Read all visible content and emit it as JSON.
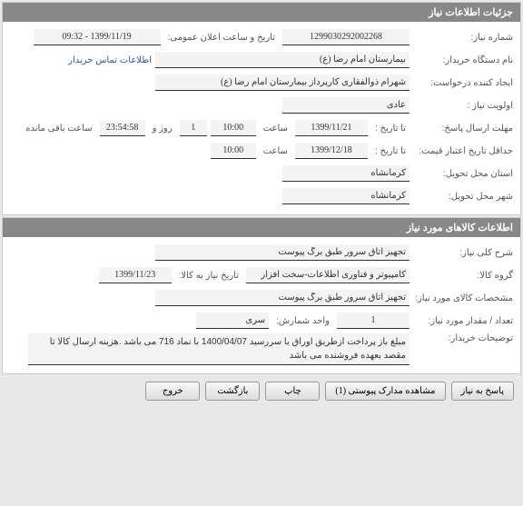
{
  "sections": {
    "info": {
      "title": "جزئیات اطلاعات نیاز"
    },
    "goods": {
      "title": "اطلاعات کالاهای مورد نیاز"
    }
  },
  "labels": {
    "request_no": "شماره نیاز:",
    "announce_datetime": "تاریخ و ساعت اعلان عمومی:",
    "buyer_name": "نام دستگاه خریدار:",
    "contact_link": "اطلاعات تماس خریدار",
    "requester": "ایجاد کننده درخواست:",
    "priority": "اولویت نیاز :",
    "deadline": "مهلت ارسال پاسخ:",
    "to_date": "تا تاریخ :",
    "time": "ساعت",
    "day_and": "روز و",
    "remaining": "ساعت باقی مانده",
    "min_validity": "حداقل تاریخ اعتبار قیمت:",
    "delivery_province": "استان محل تحویل:",
    "delivery_city": "شهر محل تحویل:",
    "general_desc": "شرح کلی نیاز:",
    "goods_group": "گروه کالا:",
    "goods_date": "تاریخ نیاز به کالا:",
    "goods_spec": "مشخصات کالای مورد نیاز:",
    "qty": "تعداد / مقدار مورد نیاز:",
    "unit": "واحد شمارش:",
    "buyer_notes": "توضیحات خریدار:"
  },
  "values": {
    "request_no": "1299030292002268",
    "announce_datetime": "1399/11/19 - 09:32",
    "buyer_name": "بیمارستان امام رضا (ع)",
    "requester": "شهرام ذوالفقاری کارپرداز بیمارستان امام رضا (ع)",
    "priority": "عادی",
    "deadline_date": "1399/11/21",
    "deadline_time": "10:00",
    "remaining_day": "1",
    "remaining_time": "23:54:58",
    "validity_date": "1399/12/18",
    "validity_time": "10:00",
    "province": "کرمانشاه",
    "city": "کرمانشاه",
    "general_desc": "تجهیز اتاق سرور طبق برگ پیوست",
    "goods_group": "کامپیوتر و فناوری اطلاعات-سخت افزار",
    "goods_date": "1399/11/23",
    "goods_spec": "تجهیز اتاق سرور طبق برگ پیوست",
    "qty": "1",
    "unit": "سری",
    "buyer_notes": "مبلغ باز پرداخت ازطریق اوراق با سررسید 1400/04/07 با نماد 716 می باشد .هزینه ارسال کالا تا مقصد بعهده فروشنده می باشد"
  },
  "buttons": {
    "reply": "پاسخ به نیاز",
    "attachments": "مشاهده مدارک پیوستی (1)",
    "print": "چاپ",
    "back": "بازگشت",
    "exit": "خروج"
  }
}
